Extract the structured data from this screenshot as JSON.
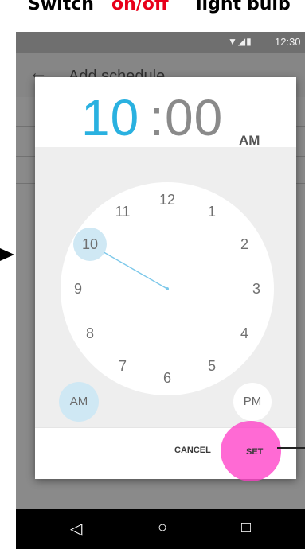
{
  "caption": {
    "w1": "Switch",
    "w2": "on/off",
    "w3": "light",
    "w4": "bulb"
  },
  "status": {
    "icons": "▼◢▮",
    "time": "12:30"
  },
  "app_bar": {
    "title": "Add schedule"
  },
  "time_picker": {
    "hour": "10",
    "colon": ":",
    "minute": "00",
    "ampm": "AM",
    "selected_hour": 10,
    "hours": [
      "12",
      "1",
      "2",
      "3",
      "4",
      "5",
      "6",
      "7",
      "8",
      "9",
      "10",
      "11"
    ],
    "am_label": "AM",
    "pm_label": "PM"
  },
  "actions": {
    "cancel": "CANCEL",
    "set": "SET"
  },
  "colors": {
    "accent": "#2ab1e0",
    "selection": "#cfe8f4",
    "highlight": "#ff40c8",
    "caption_red": "#e8001b"
  }
}
